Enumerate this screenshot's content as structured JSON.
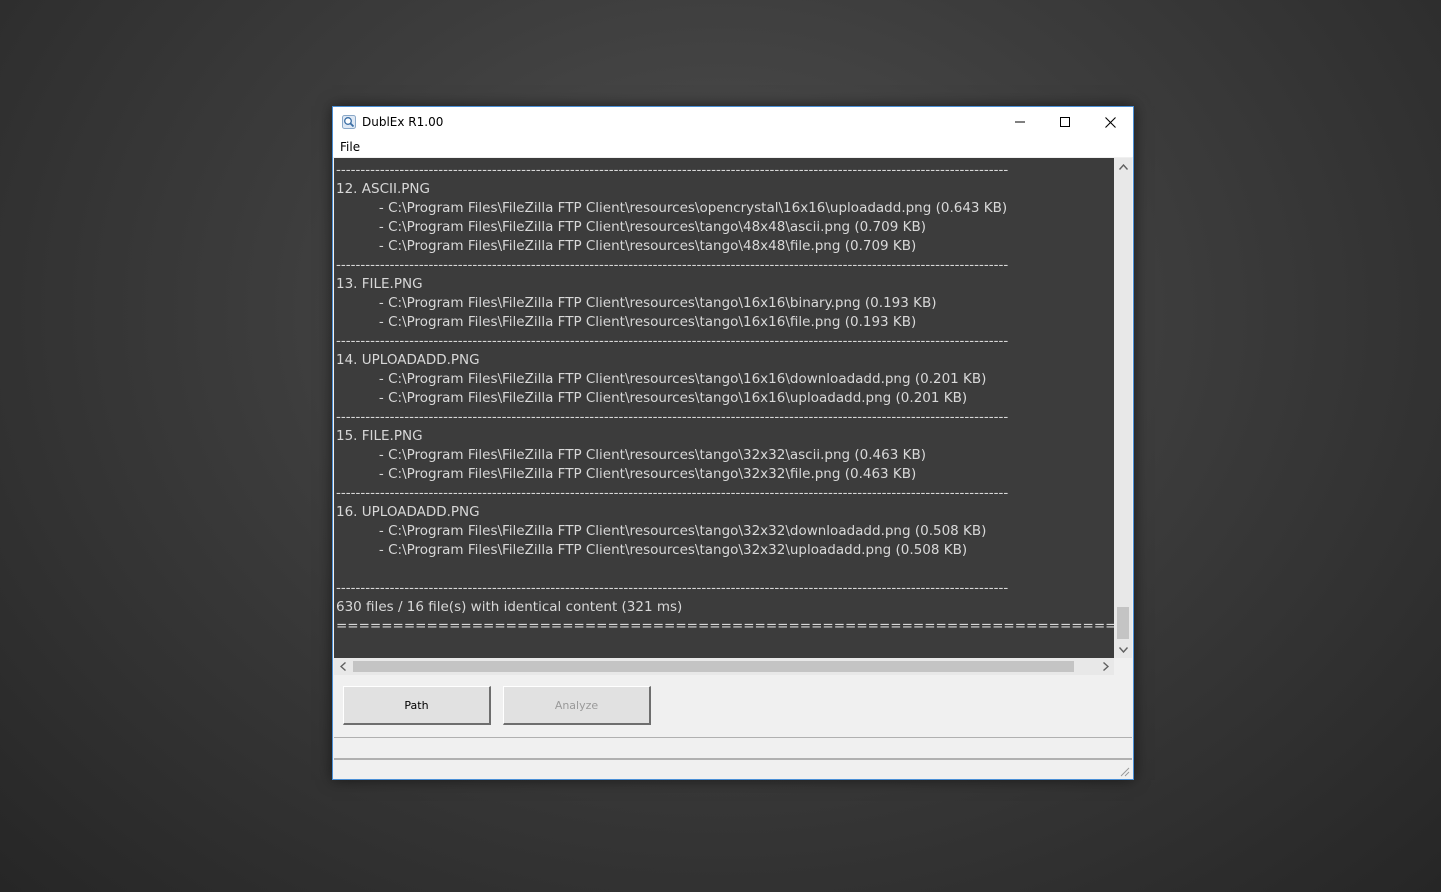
{
  "window": {
    "title": "DublEx R1.00",
    "icon": "magnifier-icon"
  },
  "titlebar_buttons": [
    "minimize-icon",
    "maximize-icon",
    "close-icon"
  ],
  "menu": {
    "file_label": "File"
  },
  "output": {
    "lines": [
      "------------------------------------------------------------------------------------------------------------------------------------------",
      "12. ASCII.PNG",
      "          - C:\\Program Files\\FileZilla FTP Client\\resources\\opencrystal\\16x16\\uploadadd.png (0.643 KB)",
      "          - C:\\Program Files\\FileZilla FTP Client\\resources\\tango\\48x48\\ascii.png (0.709 KB)",
      "          - C:\\Program Files\\FileZilla FTP Client\\resources\\tango\\48x48\\file.png (0.709 KB)",
      "------------------------------------------------------------------------------------------------------------------------------------------",
      "13. FILE.PNG",
      "          - C:\\Program Files\\FileZilla FTP Client\\resources\\tango\\16x16\\binary.png (0.193 KB)",
      "          - C:\\Program Files\\FileZilla FTP Client\\resources\\tango\\16x16\\file.png (0.193 KB)",
      "------------------------------------------------------------------------------------------------------------------------------------------",
      "14. UPLOADADD.PNG",
      "          - C:\\Program Files\\FileZilla FTP Client\\resources\\tango\\16x16\\downloadadd.png (0.201 KB)",
      "          - C:\\Program Files\\FileZilla FTP Client\\resources\\tango\\16x16\\uploadadd.png (0.201 KB)",
      "------------------------------------------------------------------------------------------------------------------------------------------",
      "15. FILE.PNG",
      "          - C:\\Program Files\\FileZilla FTP Client\\resources\\tango\\32x32\\ascii.png (0.463 KB)",
      "          - C:\\Program Files\\FileZilla FTP Client\\resources\\tango\\32x32\\file.png (0.463 KB)",
      "------------------------------------------------------------------------------------------------------------------------------------------",
      "16. UPLOADADD.PNG",
      "          - C:\\Program Files\\FileZilla FTP Client\\resources\\tango\\32x32\\downloadadd.png (0.508 KB)",
      "          - C:\\Program Files\\FileZilla FTP Client\\resources\\tango\\32x32\\uploadadd.png (0.508 KB)",
      "",
      "------------------------------------------------------------------------------------------------------------------------------------------",
      "630 files / 16 file(s) with identical content (321 ms)",
      "=================================================================================================="
    ]
  },
  "buttons": {
    "path_label": "Path",
    "analyze_label": "Analyze"
  },
  "colors": {
    "output_background": "#3c3c3c",
    "output_text": "#d8d8d8",
    "window_border": "#4a8fd6"
  }
}
